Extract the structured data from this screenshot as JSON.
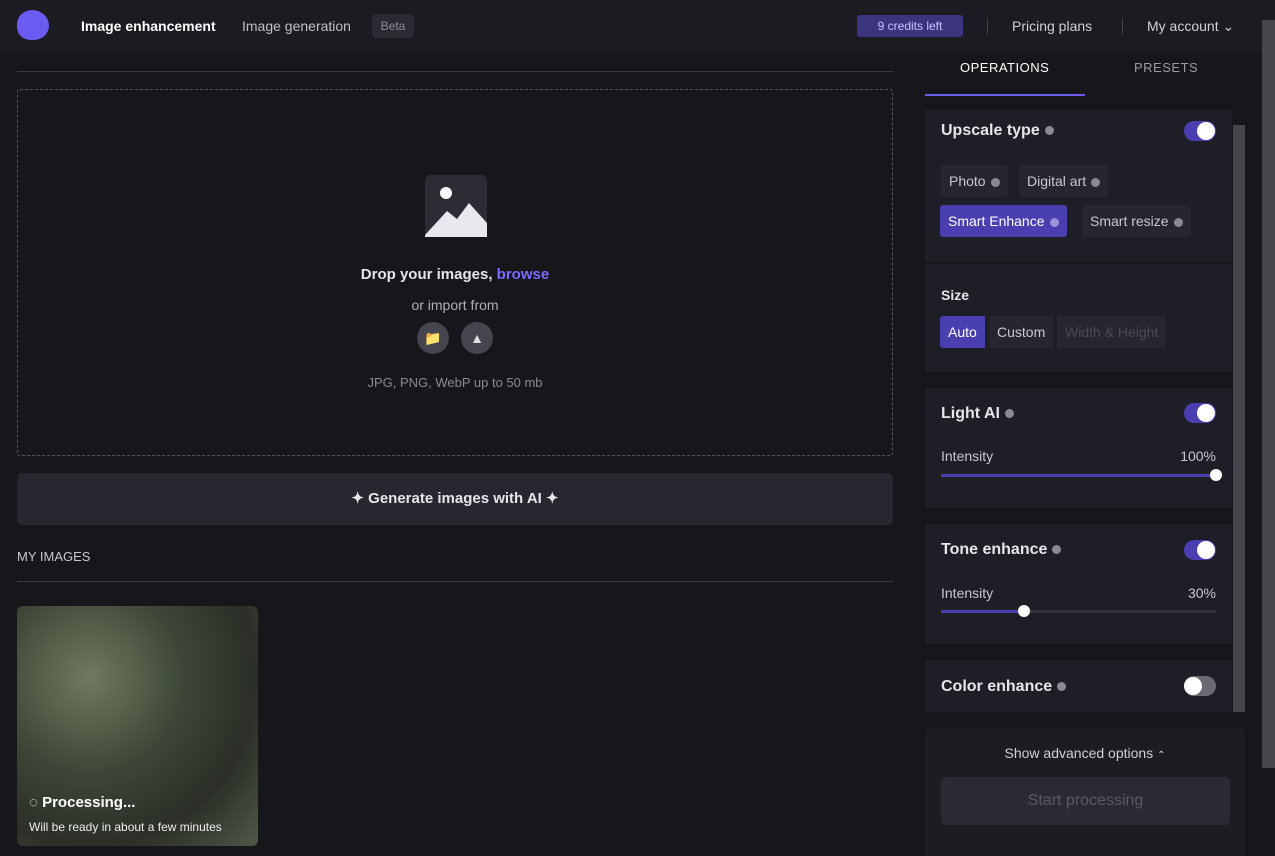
{
  "header": {
    "nav": [
      "Image enhancement",
      "Image generation"
    ],
    "beta": "Beta",
    "credits": "9 credits left",
    "pricing": "Pricing plans",
    "account": "My account"
  },
  "upload": {
    "drop_text": "Drop your images,",
    "browse": "browse",
    "import_from": "or import from",
    "formats": "JPG, PNG, WebP up to 50 mb"
  },
  "generate_label": "Generate images with AI",
  "my_images": {
    "title": "MY IMAGES",
    "items": [
      {
        "status": "Processing...",
        "note": "Will be ready in about a few minutes"
      }
    ]
  },
  "sidebar": {
    "tabs": [
      "OPERATIONS",
      "PRESETS"
    ],
    "upscale": {
      "title": "Upscale type",
      "enabled": true,
      "options": [
        "Photo",
        "Digital art",
        "Smart Enhance",
        "Smart resize"
      ],
      "selected": "Smart Enhance"
    },
    "size": {
      "title": "Size",
      "options": [
        "Auto",
        "Custom"
      ],
      "selected": "Auto",
      "placeholder": "Width & Height"
    },
    "light_ai": {
      "title": "Light AI",
      "enabled": true,
      "intensity_label": "Intensity",
      "value": "100%",
      "fraction": 1.0
    },
    "tone": {
      "title": "Tone enhance",
      "enabled": true,
      "intensity_label": "Intensity",
      "value": "30%",
      "fraction": 0.3
    },
    "color": {
      "title": "Color enhance",
      "enabled": false
    },
    "advanced": "Show advanced options",
    "start": "Start processing"
  },
  "colors": {
    "accent": "#4a3fb0",
    "link": "#7b6cff"
  }
}
